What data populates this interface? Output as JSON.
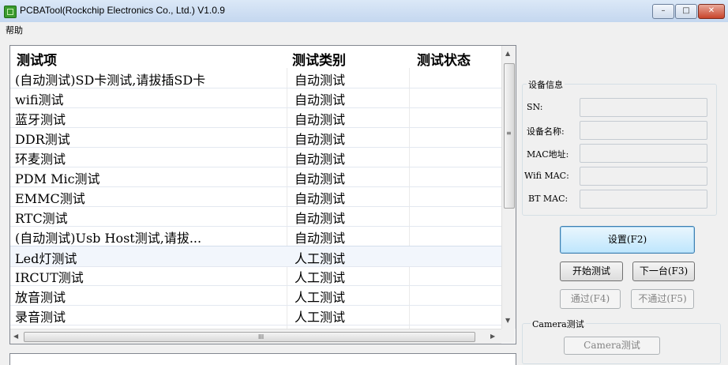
{
  "window": {
    "title": "PCBATool(Rockchip Electronics Co., Ltd.) V1.0.9",
    "min": "–",
    "max": "□",
    "close": "✕"
  },
  "menu": {
    "items": [
      "帮助"
    ]
  },
  "grid": {
    "columns": [
      "测试项",
      "测试类别",
      "测试状态"
    ],
    "rows": [
      {
        "item": "(自动测试)SD卡测试,请拔插SD卡",
        "category": "自动测试",
        "status": ""
      },
      {
        "item": "wifi测试",
        "category": "自动测试",
        "status": ""
      },
      {
        "item": "蓝牙测试",
        "category": "自动测试",
        "status": ""
      },
      {
        "item": "DDR测试",
        "category": "自动测试",
        "status": ""
      },
      {
        "item": "环麦测试",
        "category": "自动测试",
        "status": ""
      },
      {
        "item": "PDM Mic测试",
        "category": "自动测试",
        "status": ""
      },
      {
        "item": "EMMC测试",
        "category": "自动测试",
        "status": ""
      },
      {
        "item": "RTC测试",
        "category": "自动测试",
        "status": ""
      },
      {
        "item": "(自动测试)Usb Host测试,请拔...",
        "category": "自动测试",
        "status": ""
      },
      {
        "item": "Led灯测试",
        "category": "人工测试",
        "status": ""
      },
      {
        "item": "IRCUT测试",
        "category": "人工测试",
        "status": ""
      },
      {
        "item": "放音测试",
        "category": "人工测试",
        "status": ""
      },
      {
        "item": "录音测试",
        "category": "人工测试",
        "status": ""
      }
    ],
    "scroll_up": "▲",
    "scroll_down": "▼",
    "scroll_left": "◀",
    "scroll_right": "▶",
    "grip": "III",
    "vgrip": "≡"
  },
  "device_info": {
    "title": "设备信息",
    "fields": [
      {
        "label": "SN:",
        "value": ""
      },
      {
        "label": "设备名称:",
        "value": ""
      },
      {
        "label": "MAC地址:",
        "value": ""
      },
      {
        "label": "Wifi MAC:",
        "value": ""
      },
      {
        "label": "BT MAC:",
        "value": ""
      }
    ]
  },
  "buttons": {
    "settings": "设置(F2)",
    "start": "开始测试",
    "next": "下一台(F3)",
    "pass": "通过(F4)",
    "fail": "不通过(F5)"
  },
  "camera": {
    "title": "Camera测试",
    "button": "Camera测试"
  }
}
